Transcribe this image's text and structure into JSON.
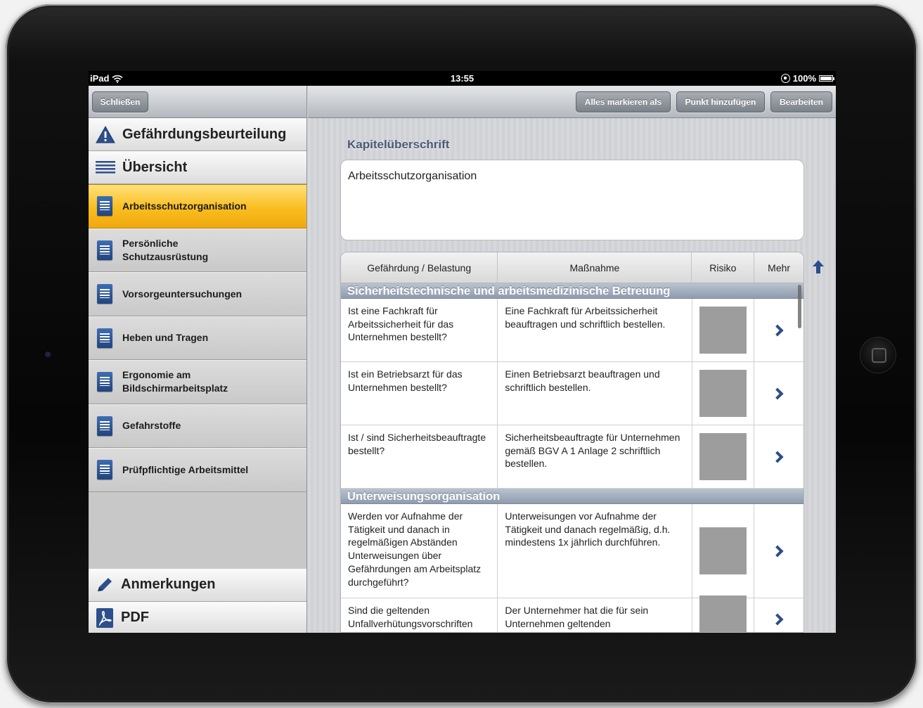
{
  "status": {
    "carrier": "iPad",
    "time": "13:55",
    "battery": "100%"
  },
  "sidebar": {
    "close_label": "Schließen",
    "title": "Gefährdungsbeurteilung",
    "overview": "Übersicht",
    "items": [
      {
        "label": "Arbeitsschutzorganisation",
        "active": true
      },
      {
        "label": "Persönliche Schutzausrüstung",
        "active": false
      },
      {
        "label": "Vorsorgeuntersuchungen",
        "active": false
      },
      {
        "label": "Heben und Tragen",
        "active": false
      },
      {
        "label": "Ergonomie am Bildschirmarbeitsplatz",
        "active": false
      },
      {
        "label": "Gefahrstoffe",
        "active": false
      },
      {
        "label": "Prüfpflichtige Arbeitsmittel",
        "active": false
      }
    ],
    "notes": "Anmerkungen",
    "pdf": "PDF"
  },
  "toolbar": {
    "mark_all": "Alles markieren als",
    "add_point": "Punkt hinzufügen",
    "edit": "Bearbeiten"
  },
  "main": {
    "heading_label": "Kapitelüberschrift",
    "heading_value": "Arbeitsschutzorganisation"
  },
  "table": {
    "columns": [
      "Gefährdung / Belastung",
      "Maßnahme",
      "Risiko",
      "Mehr"
    ],
    "groups": [
      {
        "title": "Sicherheitstechnische und arbeitsmedizinische Betreuung",
        "rows": [
          {
            "hazard": "Ist eine Fachkraft für Arbeitssicherheit für das Unternehmen bestellt?",
            "measure": "Eine Fachkraft für Arbeitssicherheit beauftragen und schriftlich bestellen."
          },
          {
            "hazard": "Ist ein Betriebsarzt für das Unternehmen bestellt?",
            "measure": "Einen Betriebsarzt beauftragen und schriftlich bestellen."
          },
          {
            "hazard": "Ist / sind Sicherheitsbeauftragte bestellt?",
            "measure": "Sicherheitsbeauftragte für Unternehmen gemäß BGV A 1 Anlage 2 schriftlich bestellen."
          }
        ]
      },
      {
        "title": "Unterweisungsorganisation",
        "rows": [
          {
            "hazard": "Werden vor Aufnahme der Tätigkeit und danach in regelmäßigen Abständen Unterweisungen über Gefährdungen am Arbeitsplatz durchgeführt?",
            "measure": "Unterweisungen vor Aufnahme der Tätigkeit und danach regelmäßig, d.h. mindestens 1x jährlich durchführen."
          },
          {
            "hazard": "Sind die geltenden Unfallverhütungsvorschriften",
            "measure": "Der Unternehmer hat die für sein Unternehmen geltenden"
          }
        ]
      }
    ]
  }
}
